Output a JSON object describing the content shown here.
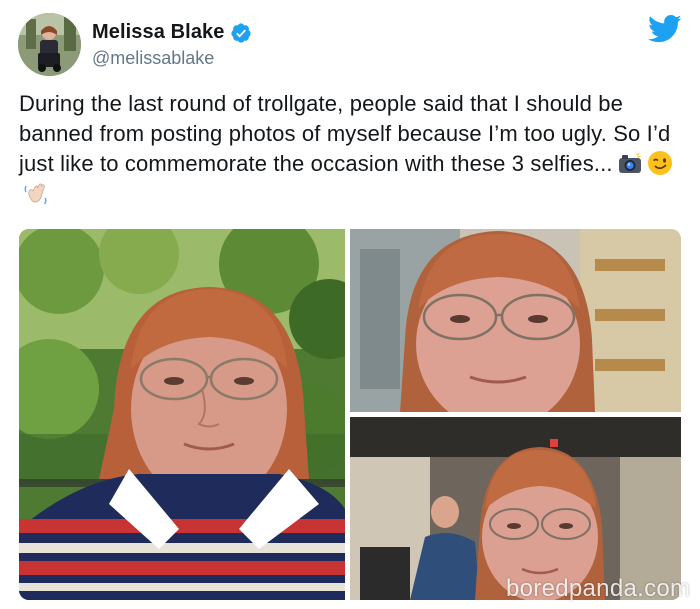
{
  "author": {
    "display_name": "Melissa Blake",
    "handle": "@melissablake",
    "verified": true,
    "verified_icon": "verified-badge-icon",
    "avatar_alt": "avatar"
  },
  "platform_icon": "twitter-bird-icon",
  "colors": {
    "twitter_blue": "#1da1f2",
    "text": "#14171a",
    "secondary_text": "#657786"
  },
  "tweet": {
    "text": "During the last round of trollgate, people said that I should be banned from posting photos of myself because I’m too ugly. So I’d just like to commemorate the occasion with these 3 selfies...",
    "emojis": [
      "camera-with-flash-icon",
      "winking-face-icon",
      "waving-hand-icon"
    ]
  },
  "media": {
    "photo_count": 3,
    "watermark": "boredpanda.com"
  }
}
